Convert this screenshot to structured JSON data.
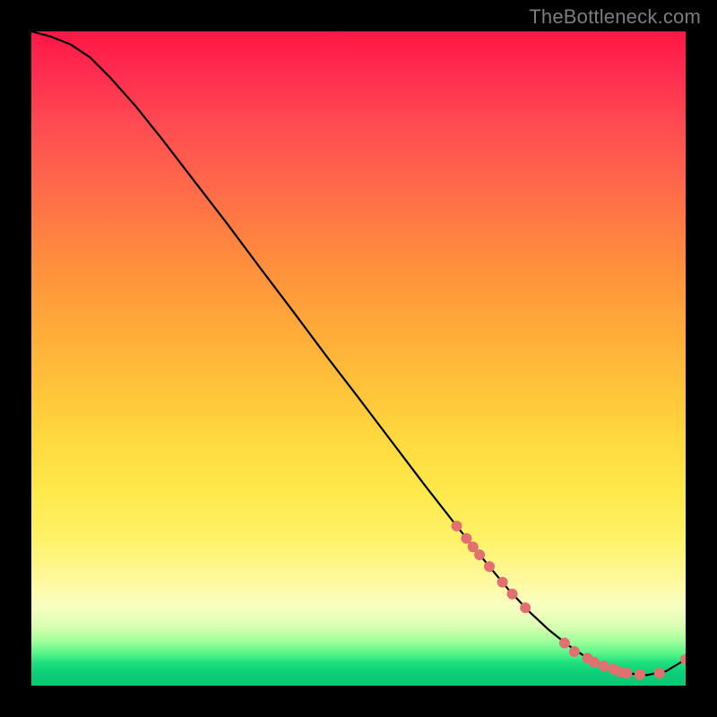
{
  "watermark": "TheBottleneck.com",
  "chart_data": {
    "type": "line",
    "title": "",
    "xlabel": "",
    "ylabel": "",
    "xlim": [
      0,
      100
    ],
    "ylim": [
      0,
      100
    ],
    "grid": false,
    "legend": false,
    "background": "vertical-gradient-red-to-green",
    "series": [
      {
        "name": "bottleneck-curve",
        "color": "#000000",
        "x": [
          0,
          3,
          6,
          9,
          12,
          16,
          20,
          25,
          30,
          35,
          40,
          45,
          50,
          55,
          60,
          65,
          70,
          73,
          76,
          79,
          82,
          85,
          88,
          91,
          94,
          97,
          100
        ],
        "y": [
          100,
          99.2,
          98,
          96,
          93,
          88.5,
          83.5,
          77,
          70.5,
          63.8,
          57.2,
          50.5,
          44,
          37.4,
          30.8,
          24.4,
          18.2,
          14.6,
          11.4,
          8.6,
          6.2,
          4.2,
          2.8,
          1.9,
          1.6,
          2.2,
          4.0
        ]
      }
    ],
    "markers": {
      "name": "highlight-points",
      "color": "#e27070",
      "radius": 6,
      "points": [
        {
          "x": 65,
          "y": 24.4
        },
        {
          "x": 66.5,
          "y": 22.5
        },
        {
          "x": 67.5,
          "y": 21.2
        },
        {
          "x": 68.5,
          "y": 20.0
        },
        {
          "x": 70,
          "y": 18.2
        },
        {
          "x": 72,
          "y": 15.8
        },
        {
          "x": 73.5,
          "y": 14.0
        },
        {
          "x": 75.5,
          "y": 11.9
        },
        {
          "x": 81.5,
          "y": 6.5
        },
        {
          "x": 83,
          "y": 5.2
        },
        {
          "x": 85,
          "y": 4.2
        },
        {
          "x": 86,
          "y": 3.6
        },
        {
          "x": 87.5,
          "y": 3.0
        },
        {
          "x": 89,
          "y": 2.5
        },
        {
          "x": 90,
          "y": 2.1
        },
        {
          "x": 91,
          "y": 1.9
        },
        {
          "x": 93,
          "y": 1.7
        },
        {
          "x": 96,
          "y": 1.9
        },
        {
          "x": 100,
          "y": 4.0
        }
      ]
    }
  }
}
